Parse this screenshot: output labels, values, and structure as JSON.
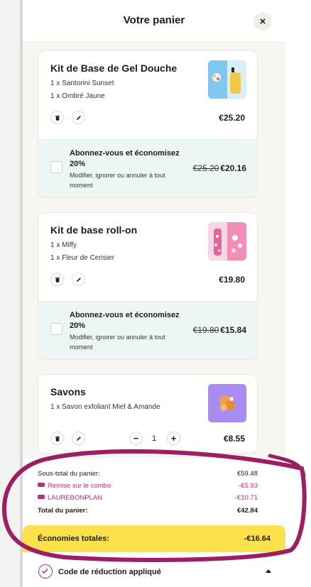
{
  "header": {
    "title": "Votre panier",
    "close_icon": "×"
  },
  "items": [
    {
      "title": "Kit de Base de Gel Douche",
      "variants": [
        "1 x Santorini Sunset",
        "1 x Ombré Jaune"
      ],
      "price": "€25.20",
      "subscription": {
        "title": "Abonnez-vous et économisez 20%",
        "description": "Modifier, ignorer ou annuler à tout moment",
        "old_price": "€25.20",
        "new_price": "€20.16"
      }
    },
    {
      "title": "Kit de base roll-on",
      "variants": [
        "1 x Miffy",
        "1 x Fleur de Cerisier"
      ],
      "price": "€19.80",
      "subscription": {
        "title": "Abonnez-vous et économisez 20%",
        "description": "Modifier, ignorer ou annuler à tout moment",
        "old_price": "€19.80",
        "new_price": "€15.84"
      }
    },
    {
      "title": "Savons",
      "variants": [
        "1 x Savon exfoliant Miel & Amande"
      ],
      "price": "€8.55",
      "quantity": "1",
      "qty_minus": "−",
      "qty_plus": "+"
    }
  ],
  "summary": {
    "subtotal_label": "Sous-total du panier:",
    "subtotal_value": "€59.48",
    "combo_label": "Remise sur le combo",
    "combo_value": "-€5.93",
    "code_label": "LAUREBONPLAN",
    "code_value": "-€10.71",
    "total_label": "Total du panier:",
    "total_value": "€42.84"
  },
  "savings": {
    "label": "Économies totales:",
    "value": "-€16.64"
  },
  "discount": {
    "label": "Code de réduction appliqué"
  },
  "colors": {
    "accent_pink": "#b4307a",
    "savings_yellow": "#fde14a",
    "subscription_bg": "#eef5f5",
    "panel_bg": "#f7f6f1"
  }
}
